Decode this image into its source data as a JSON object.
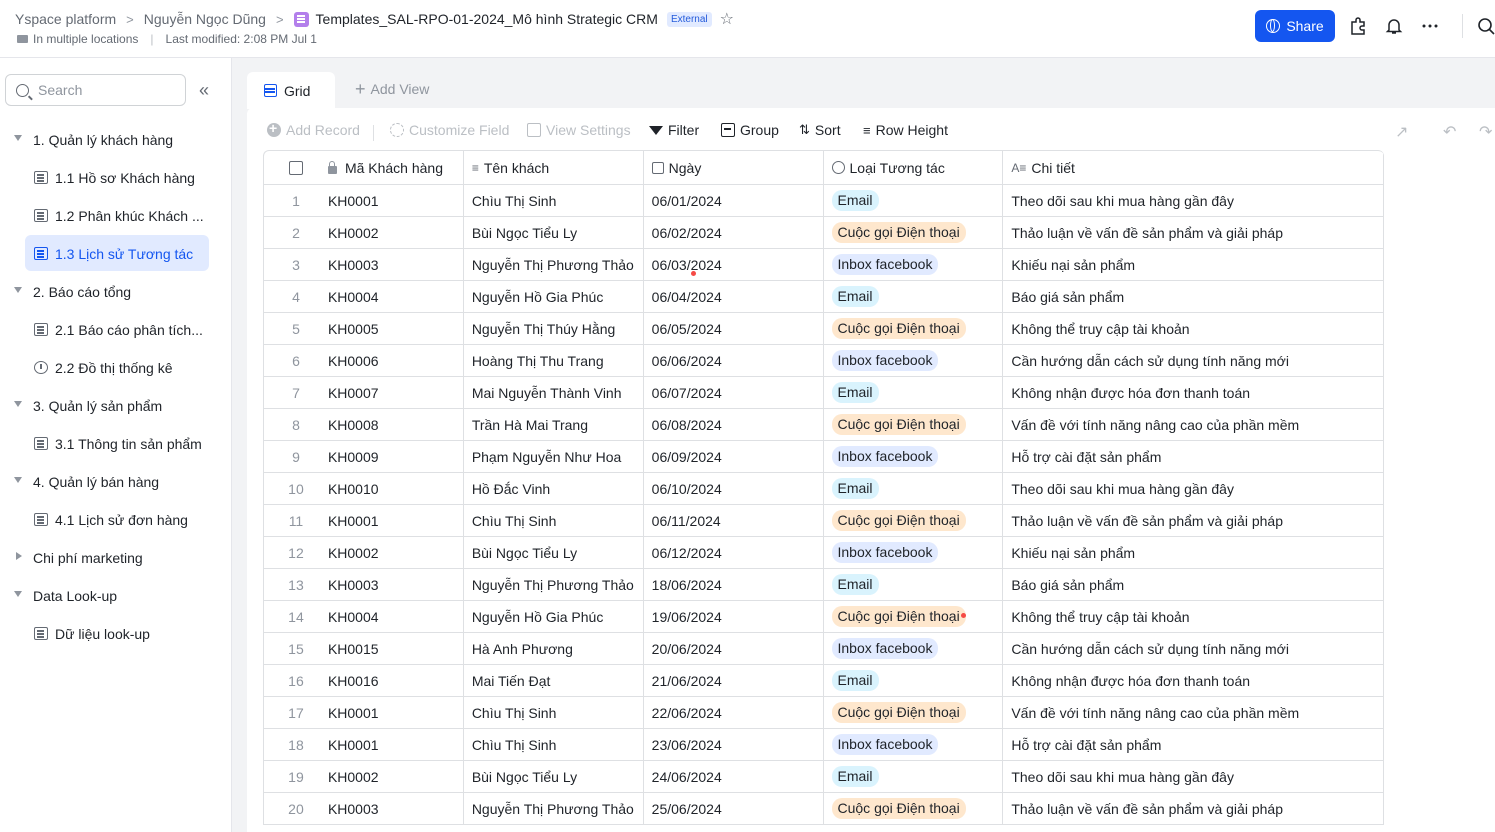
{
  "header": {
    "breadcrumbs": [
      "Yspace platform",
      "Nguyễn Ngọc Dũng"
    ],
    "doc_title": "Templates_SAL-RPO-01-2024_Mô hình Strategic CRM",
    "badge": "External",
    "location": "In multiple locations",
    "last_modified": "Last modified: 2:08 PM Jul 1",
    "share_label": "Share"
  },
  "sidebar": {
    "search_placeholder": "Search",
    "groups": [
      {
        "label": "1. Quản lý khách hàng",
        "children": [
          "1.1 Hồ sơ Khách hàng",
          "1.2 Phân khúc Khách ...",
          "1.3 Lịch sử Tương tác"
        ]
      },
      {
        "label": "2. Báo cáo tổng",
        "children": [
          "2.1 Báo cáo phân tích...",
          "2.2 Đồ thị thống kê"
        ]
      },
      {
        "label": "3. Quản lý sản phẩm",
        "children": [
          "3.1 Thông tin sản phẩm"
        ]
      },
      {
        "label": "4. Quản lý bán hàng",
        "children": [
          "4.1 Lịch sử đơn hàng"
        ]
      },
      {
        "label": "Chi phí marketing",
        "children": []
      },
      {
        "label": "Data Look-up",
        "children": [
          "Dữ liệu look-up"
        ]
      }
    ]
  },
  "view": {
    "tab": "Grid",
    "add_view": "Add View"
  },
  "toolbar": {
    "add_record": "Add Record",
    "customize_field": "Customize Field",
    "view_settings": "View Settings",
    "filter": "Filter",
    "group": "Group",
    "sort": "Sort",
    "row_height": "Row Height"
  },
  "table": {
    "columns": [
      "Mã Khách hàng",
      "Tên khách",
      "Ngày",
      "Loại Tương tác",
      "Chi tiết"
    ],
    "rows": [
      [
        "1",
        "KH0001",
        "Chìu Thị Sinh",
        "06/01/2024",
        "Email",
        "Theo dõi sau khi mua hàng gần đây"
      ],
      [
        "2",
        "KH0002",
        "Bùi Ngọc Tiểu Ly",
        "06/02/2024",
        "Cuộc gọi Điện thoại",
        "Thảo luận về vấn đề sản phẩm và giải pháp"
      ],
      [
        "3",
        "KH0003",
        "Nguyễn Thị Phương Thảo",
        "06/03/2024",
        "Inbox facebook",
        "Khiếu nại sản phẩm"
      ],
      [
        "4",
        "KH0004",
        "Nguyễn Hồ Gia Phúc",
        "06/04/2024",
        "Email",
        "Báo giá sản phẩm"
      ],
      [
        "5",
        "KH0005",
        "Nguyễn Thị Thúy Hằng",
        "06/05/2024",
        "Cuộc gọi Điện thoại",
        "Không thể truy cập tài khoản"
      ],
      [
        "6",
        "KH0006",
        "Hoàng Thị Thu Trang",
        "06/06/2024",
        "Inbox facebook",
        "Cần hướng dẫn cách sử dụng tính năng mới"
      ],
      [
        "7",
        "KH0007",
        "Mai Nguyễn Thành Vinh",
        "06/07/2024",
        "Email",
        "Không nhận được hóa đơn thanh toán"
      ],
      [
        "8",
        "KH0008",
        "Trần Hà Mai Trang",
        "06/08/2024",
        "Cuộc gọi Điện thoại",
        "Vấn đề với tính năng nâng cao của phần mềm"
      ],
      [
        "9",
        "KH0009",
        "Phạm Nguyễn Như Hoa",
        "06/09/2024",
        "Inbox facebook",
        "Hỗ trợ cài đặt sản phẩm"
      ],
      [
        "10",
        "KH0010",
        "Hồ Đắc Vinh",
        "06/10/2024",
        "Email",
        "Theo dõi sau khi mua hàng gần đây"
      ],
      [
        "11",
        "KH0001",
        "Chìu Thị Sinh",
        "06/11/2024",
        "Cuộc gọi Điện thoại",
        "Thảo luận về vấn đề sản phẩm và giải pháp"
      ],
      [
        "12",
        "KH0002",
        "Bùi Ngọc Tiểu Ly",
        "06/12/2024",
        "Inbox facebook",
        "Khiếu nại sản phẩm"
      ],
      [
        "13",
        "KH0003",
        "Nguyễn Thị Phương Thảo",
        "18/06/2024",
        "Email",
        "Báo giá sản phẩm"
      ],
      [
        "14",
        "KH0004",
        "Nguyễn Hồ Gia Phúc",
        "19/06/2024",
        "Cuộc gọi Điện thoại",
        "Không thể truy cập tài khoản"
      ],
      [
        "15",
        "KH0015",
        "Hà Anh Phương",
        "20/06/2024",
        "Inbox facebook",
        "Cần hướng dẫn cách sử dụng tính năng mới"
      ],
      [
        "16",
        "KH0016",
        "Mai Tiến Đạt",
        "21/06/2024",
        "Email",
        "Không nhận được hóa đơn thanh toán"
      ],
      [
        "17",
        "KH0001",
        "Chìu Thị Sinh",
        "22/06/2024",
        "Cuộc gọi Điện thoại",
        "Vấn đề với tính năng nâng cao của phần mềm"
      ],
      [
        "18",
        "KH0001",
        "Chìu Thị Sinh",
        "23/06/2024",
        "Inbox facebook",
        "Hỗ trợ cài đặt sản phẩm"
      ],
      [
        "19",
        "KH0002",
        "Bùi Ngọc Tiểu Ly",
        "24/06/2024",
        "Email",
        "Theo dõi sau khi mua hàng gần đây"
      ],
      [
        "20",
        "KH0003",
        "Nguyễn Thị Phương Thảo",
        "25/06/2024",
        "Cuộc gọi Điện thoại",
        "Thảo luận về vấn đề sản phẩm và giải pháp"
      ]
    ]
  },
  "colors": {
    "accent": "#1456f0",
    "tag_email": "#d9f3fd",
    "tag_call": "#fee7cd",
    "tag_inbox": "#e1eaff"
  }
}
